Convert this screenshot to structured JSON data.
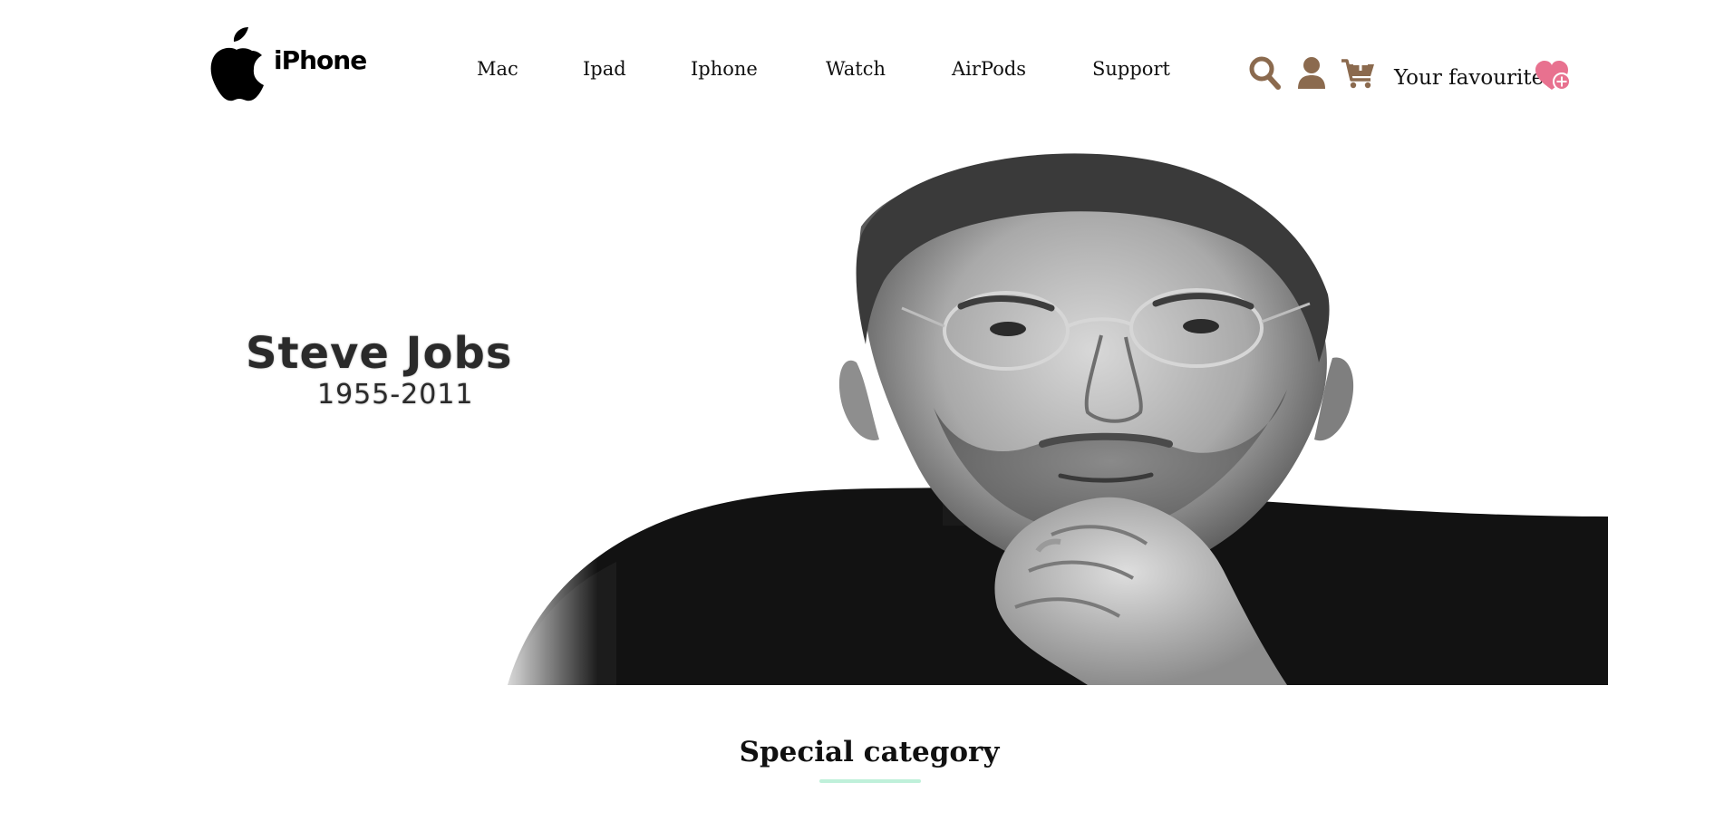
{
  "brand": {
    "logo_text": "iPhone"
  },
  "nav": {
    "items": [
      {
        "label": "Mac"
      },
      {
        "label": "Ipad"
      },
      {
        "label": "Iphone"
      },
      {
        "label": "Watch"
      },
      {
        "label": "AirPods"
      },
      {
        "label": "Support"
      }
    ]
  },
  "tools": {
    "search_icon": "search-icon",
    "user_icon": "user-icon",
    "cart_icon": "cart-plus-icon",
    "favourite_label": "Your favourite",
    "favourite_icon": "heart-plus-icon",
    "icon_color": "#8b6a4e",
    "heart_color": "#e8718f"
  },
  "hero": {
    "name": "Steve Jobs",
    "years": "1955-2011"
  },
  "section": {
    "title": "Special category",
    "underline_color": "#bff0da"
  }
}
